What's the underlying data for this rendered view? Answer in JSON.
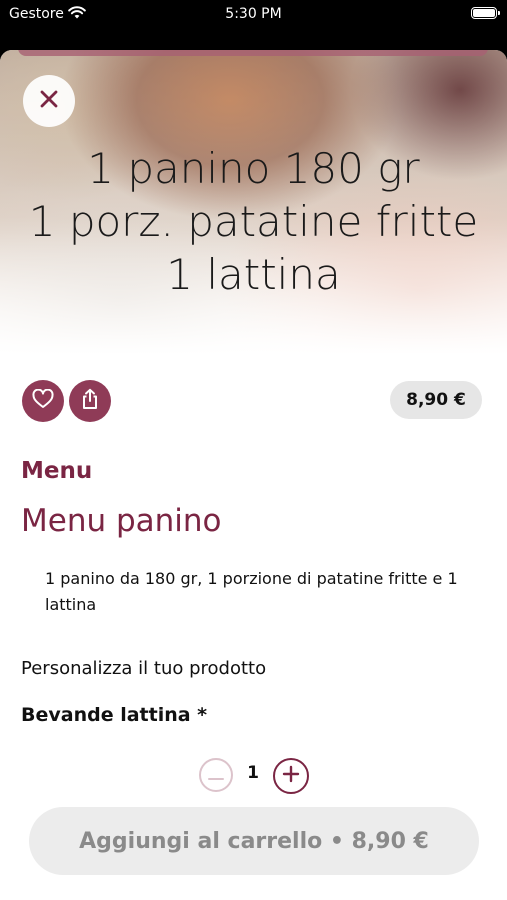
{
  "status_bar": {
    "carrier": "Gestore",
    "time": "5:30 PM"
  },
  "hero": {
    "lines": [
      "1 panino 180 gr",
      "1 porz. patatine fritte",
      "1 lattina"
    ]
  },
  "actions": {
    "favorite_icon": "heart-icon",
    "share_icon": "share-icon",
    "close_icon": "close-icon"
  },
  "product": {
    "price": "8,90 €",
    "category": "Menu",
    "name": "Menu panino",
    "description": "1 panino da 180 gr, 1 porzione di patatine fritte e 1 lattina"
  },
  "customization": {
    "heading": "Personalizza il tuo prodotto",
    "option_title": "Bevande lattina *",
    "quantity": "1"
  },
  "cart_button": {
    "label": "Aggiungi al carrello • 8,90 €"
  },
  "colors": {
    "accent": "#7a2543",
    "icon_button_bg": "#8f3b57",
    "price_pill_bg": "#e6e6e6",
    "cart_button_bg": "#ececec"
  }
}
